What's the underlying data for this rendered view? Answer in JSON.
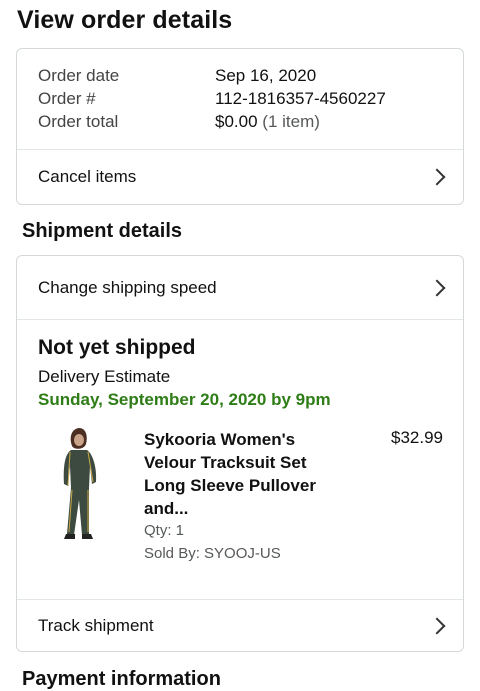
{
  "page": {
    "title": "View order details"
  },
  "order": {
    "date_label": "Order date",
    "date_value": "Sep 16, 2020",
    "number_label": "Order #",
    "number_value": "112-1816357-4560227",
    "total_label": "Order total",
    "total_value": "$0.00",
    "total_items": "(1 item)",
    "cancel_label": "Cancel items"
  },
  "shipment": {
    "section_title": "Shipment details",
    "change_speed_label": "Change shipping speed",
    "status": "Not yet shipped",
    "estimate_label": "Delivery Estimate",
    "estimate_date": "Sunday, September 20, 2020 by 9pm",
    "status_color": "#2e7d17",
    "track_label": "Track shipment",
    "item": {
      "title": "Sykooria Women's Velour Tracksuit Set Long Sleeve Pullover and...",
      "price": "$32.99",
      "qty": "Qty: 1",
      "seller": "Sold By: SYOOJ-US"
    }
  },
  "payment": {
    "section_title": "Payment information"
  },
  "icons": {
    "chevron": "chevron-right-icon",
    "product_image": "tracksuit-product-image"
  }
}
